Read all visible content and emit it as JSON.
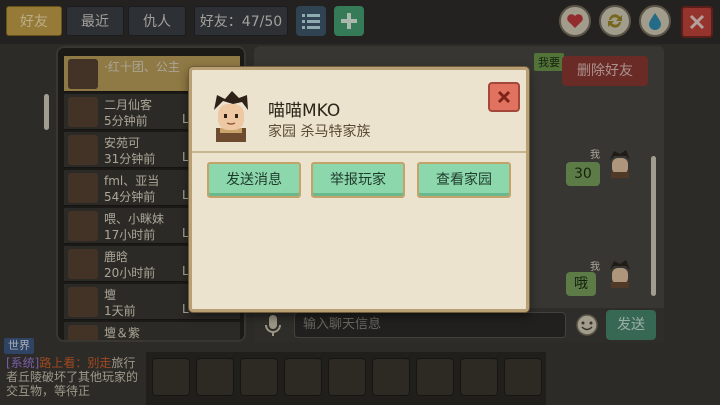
{
  "topbar": {
    "tabs": [
      {
        "label": "好友",
        "active": true
      },
      {
        "label": "最近",
        "active": false
      },
      {
        "label": "仇人",
        "active": false
      }
    ],
    "friend_count_label": "好友：47/50"
  },
  "friend_list": [
    {
      "name": "·红十团、公主",
      "time": "",
      "level": "",
      "selected": true
    },
    {
      "name": "二月仙客",
      "time": "5分钟前",
      "level": "L"
    },
    {
      "name": "安苑可",
      "time": "31分钟前",
      "level": "L"
    },
    {
      "name": "fml、亚当",
      "time": "54分钟前",
      "level": "L"
    },
    {
      "name": "喂、小眯妹",
      "time": "17小时前",
      "level": "L"
    },
    {
      "name": "鹿晗",
      "time": "20小时前",
      "level": "L"
    },
    {
      "name": "壇",
      "time": "1天前",
      "level": "L"
    },
    {
      "name": "壇＆紫",
      "time": "",
      "level": ""
    }
  ],
  "chat": {
    "me_tag": "我要",
    "delete_friend_label": "删除好友",
    "messages": [
      {
        "sender": "我",
        "text": "30"
      },
      {
        "sender": "我",
        "text": "哦"
      }
    ],
    "input_placeholder": "输入聊天信息",
    "send_label": "发送"
  },
  "world_chat": {
    "tag": "世界",
    "system_prefix": "[系统]",
    "player_name": "路上看：别走",
    "message": "旅行者丘陵破坏了其他玩家的交互物，等待正"
  },
  "dialog": {
    "player_name": "喵喵MKO",
    "subtitle": "家园  杀马特家族",
    "buttons": {
      "send_message": "发送消息",
      "report_player": "举报玩家",
      "view_home": "查看家园"
    }
  },
  "colors": {
    "accent_green": "#8dd7ad",
    "close_red": "#e0725f",
    "dialog_bg": "#ece3cf",
    "tab_active": "#c9a34a"
  }
}
